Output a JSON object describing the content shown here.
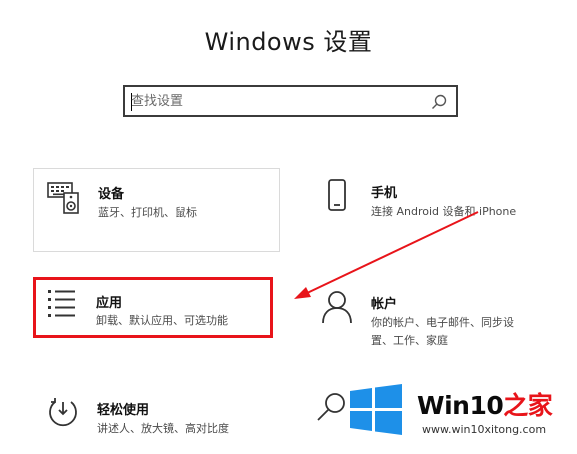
{
  "window": {
    "title": "Windows 设置"
  },
  "search": {
    "placeholder": "查找设置"
  },
  "tiles": {
    "devices": {
      "name": "设备",
      "desc": "蓝牙、打印机、鼠标",
      "icon": "keyboard-speaker-icon"
    },
    "phone": {
      "name": "手机",
      "desc": "连接 Android 设备和 iPhone",
      "icon": "phone-icon"
    },
    "apps": {
      "name": "应用",
      "desc": "卸载、默认应用、可选功能",
      "icon": "apps-list-icon"
    },
    "accounts": {
      "name": "帐户",
      "desc_line1": "你的帐户、电子邮件、同步设",
      "desc_line2": "置、工作、家庭",
      "icon": "person-icon"
    },
    "ease": {
      "name": "轻松使用",
      "desc": "讲述人、放大镜、高对比度",
      "icon": "timer-icon"
    },
    "search_tile": {
      "icon": "search-icon"
    }
  },
  "annotation": {
    "highlight_color": "#e8141a",
    "arrow_color": "#e8141a"
  },
  "watermark": {
    "brand_main": "Win10",
    "brand_zh": "之家",
    "url": "www.win10xitong.com",
    "logo_color": "#1e90e8"
  }
}
